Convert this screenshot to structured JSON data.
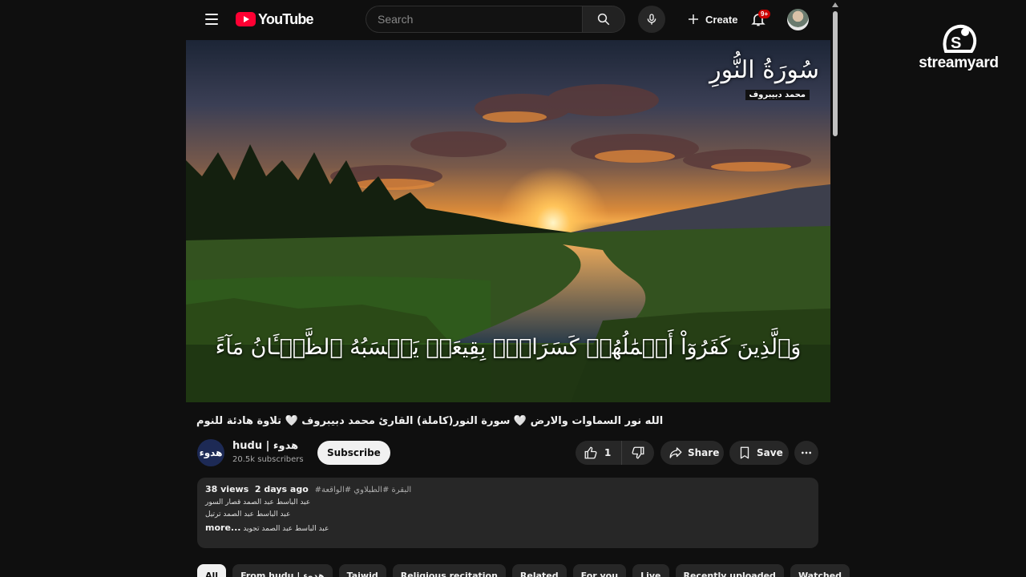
{
  "masthead": {
    "logo_text": "YouTube",
    "search_placeholder": "Search",
    "create_label": "Create",
    "notification_badge": "9+"
  },
  "video": {
    "overlay_surah": "سُورَةُ النُّورِ",
    "overlay_reciter": "محمد دبيبروف",
    "ayah_text": "وَٱلَّذِينَ كَفَرُوٓاْ أَعۡمَٰلُهُمۡ كَسَرَابِۭ بِقِيعَةٖ يَحۡسَبُهُ ٱلظَّمۡـَٔانُ مَآءً"
  },
  "title": "الله نور السماوات والارض 🤍 سورة النور(كاملة) القارئ محمد دبيبروف 🤍 تلاوة هادئة للنوم",
  "channel": {
    "avatar_text": "هدوء",
    "name": "hudu | هدوء",
    "subscribers": "20.5k subscribers",
    "subscribe_label": "Subscribe"
  },
  "actions": {
    "like_count": "1",
    "share_label": "Share",
    "save_label": "Save"
  },
  "description": {
    "views": "38 views",
    "date": "2 days ago",
    "tags": "#البقرة #الطبلاوي #الواقعة",
    "lines": [
      "عبد الباسط عبد الصمد قصار السور",
      "عبد الباسط عبد الصمد ترتيل",
      "عبد الباسط عبد الصمد تجويد"
    ],
    "more_label": "...more"
  },
  "chips": [
    "All",
    "From hudu | هدوء",
    "Tajwid",
    "Religious recitation",
    "Related",
    "For you",
    "Live",
    "Recently uploaded",
    "Watched"
  ],
  "streamyard": {
    "wordmark": "streamyard"
  },
  "colors": {
    "background": "#0f0f0f",
    "youtube_red": "#ff0033",
    "surface": "#272727"
  }
}
